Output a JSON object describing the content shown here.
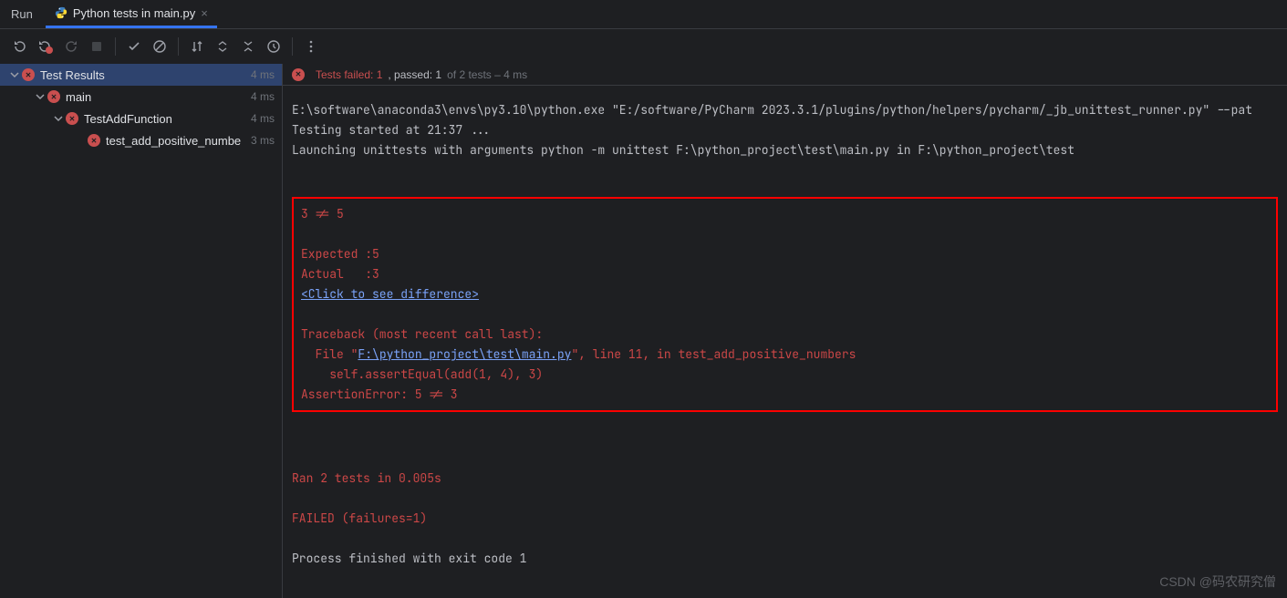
{
  "tab_bar": {
    "run_label": "Run",
    "tab_title": "Python tests in main.py",
    "close": "×"
  },
  "tree": {
    "root": {
      "label": "Test Results",
      "time": "4 ms"
    },
    "main": {
      "label": "main",
      "time": "4 ms"
    },
    "cls": {
      "label": "TestAddFunction",
      "time": "4 ms"
    },
    "test": {
      "label": "test_add_positive_numbe",
      "time": "3 ms"
    }
  },
  "console_header": {
    "fail_label": "Tests failed: ",
    "fail_count": "1",
    "pass_label": ", passed: ",
    "pass_count": "1",
    "of_text": " of 2 tests – 4 ms"
  },
  "console": {
    "line1": "E:\\software\\anaconda3\\envs\\py3.10\\python.exe \"E:/software/PyCharm 2023.3.1/plugins/python/helpers/pycharm/_jb_unittest_runner.py\" --pat",
    "line2": "Testing started at 21:37 ...",
    "line3": "Launching unittests with arguments python -m unittest F:\\python_project\\test\\main.py in F:\\python_project\\test",
    "err1": "3 != 5",
    "exp_label": "Expected :",
    "exp_val": "5",
    "act_label": "Actual   :",
    "act_val": "3",
    "diff_link": "<Click to see difference>",
    "tb_head": "Traceback (most recent call last):",
    "tb_file_pre": "  File \"",
    "tb_file_link": "F:\\python_project\\test\\main.py",
    "tb_file_post": "\", line 11, in test_add_positive_numbers",
    "tb_code": "    self.assertEqual(add(1, 4), 3)",
    "tb_err": "AssertionError: 5 != 3",
    "ran": "Ran 2 tests in 0.005s",
    "failed": "FAILED (failures=1)",
    "exit": "Process finished with exit code 1"
  },
  "watermark": "CSDN @码农研究僧"
}
